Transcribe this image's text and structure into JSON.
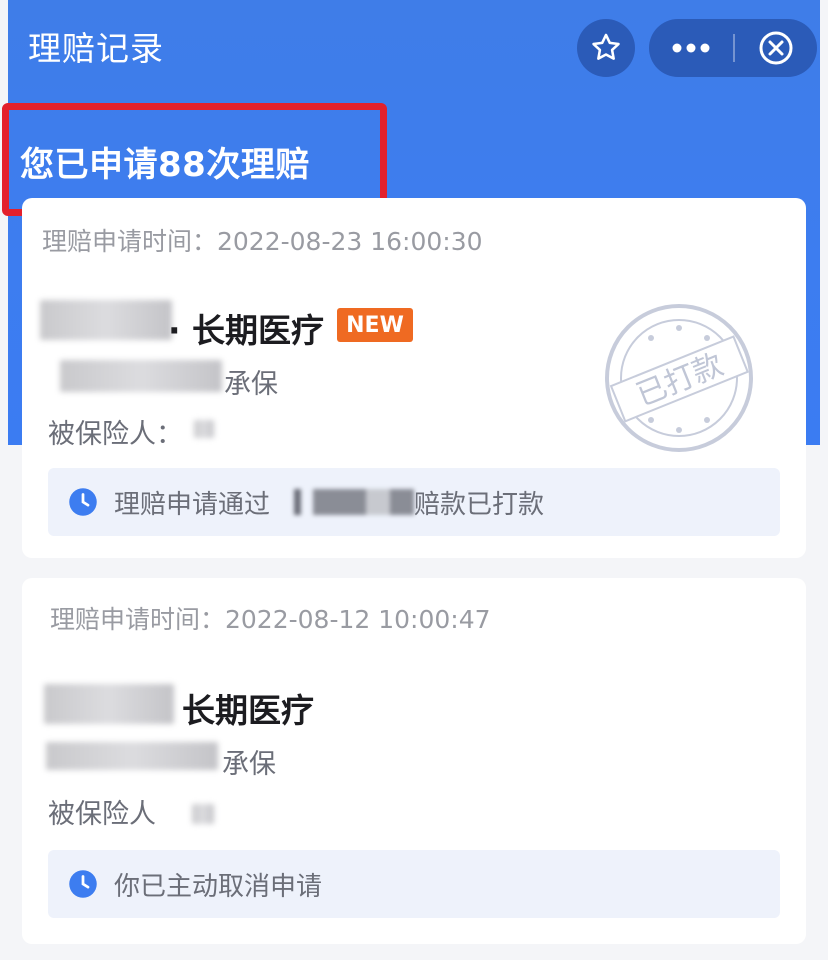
{
  "header": {
    "title": "理赔记录",
    "summary": "您已申请88次理赔"
  },
  "icons": {
    "favorite": "star-icon",
    "more": "more-dots-icon",
    "close": "close-circle-icon",
    "status": "clock-icon"
  },
  "colors": {
    "header_bg": "#3d7df0",
    "highlight_border": "#e3202c",
    "new_badge": "#ef6a22",
    "status_icon": "#3d7df0"
  },
  "claims": [
    {
      "time_label": "理赔申请时间：2022-08-23 16:00:30",
      "product_suffix": "· 长期医疗",
      "badge": "NEW",
      "underwriter_suffix": "承保",
      "insured_label": "被保险人：",
      "status_prefix": "理赔申请通过",
      "status_suffix": "赔款已打款",
      "stamp_text": "已打款"
    },
    {
      "time_label": "理赔申请时间：2022-08-12 10:00:47",
      "product_suffix": "长期医疗",
      "underwriter_suffix": "承保",
      "insured_label": "被保险人",
      "status_text": "你已主动取消申请"
    }
  ]
}
